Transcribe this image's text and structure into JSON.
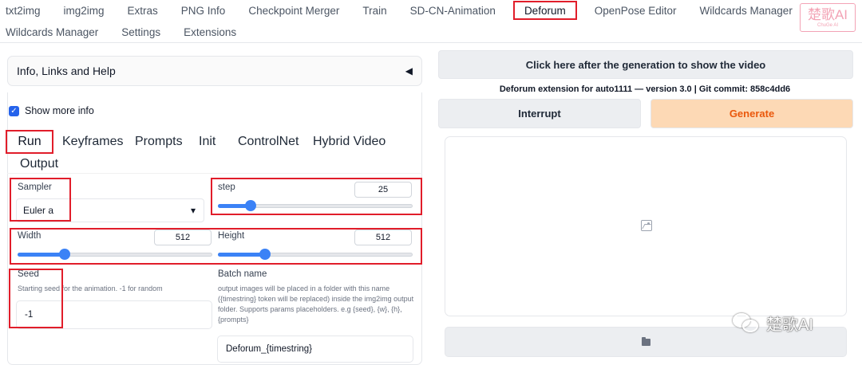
{
  "nav": {
    "tabs_row1": [
      "txt2img",
      "img2img",
      "Extras",
      "PNG Info",
      "Checkpoint Merger",
      "Train",
      "SD-CN-Animation",
      "Deforum",
      "OpenPose Editor",
      "Wildcards Manager"
    ],
    "tabs_row2": [
      "Wildcards Manager",
      "Settings",
      "Extensions"
    ],
    "active_tab": "Deforum",
    "logo_text": "楚歌AI",
    "logo_subtext": "ChuGe AI"
  },
  "left": {
    "accordion_label": "Info, Links and Help",
    "accordion_caret": "◀",
    "show_more_info_label": "Show more info",
    "show_more_info_checked": true,
    "subtabs": [
      "Run",
      "Keyframes",
      "Prompts",
      "Init",
      "ControlNet",
      "Hybrid Video",
      "Output"
    ],
    "active_subtab": "Run",
    "sampler": {
      "label": "Sampler",
      "value": "Euler a",
      "arrow": "▾"
    },
    "step": {
      "label": "step",
      "value": "25",
      "fraction": 0.17
    },
    "width": {
      "label": "Width",
      "value": "512",
      "fraction": 0.24
    },
    "height": {
      "label": "Height",
      "value": "512",
      "fraction": 0.24
    },
    "seed": {
      "label": "Seed",
      "hint": "Starting seed for the animation. -1 for random",
      "value": "-1"
    },
    "batch_name": {
      "label": "Batch name",
      "hint": "output images will be placed in a folder with this name ({timestring} token will be replaced) inside the img2img output folder. Supports params placeholders. e.g {seed}, {w}, {h}, {prompts}",
      "value": "Deforum_{timestring}"
    }
  },
  "right": {
    "show_video_button": "Click here after the generation to show the video",
    "version_text": "Deforum extension for auto1111 — version 3.0 | Git commit: 858c4dd6",
    "interrupt_button": "Interrupt",
    "generate_button": "Generate",
    "output_icon": "image-placeholder-icon",
    "folder_icon": "folder-icon"
  },
  "watermark": {
    "text": "楚歌AI"
  },
  "colors": {
    "accent": "#3b82f6",
    "highlight": "#e11d2a",
    "generate_bg": "#fdd9b5",
    "generate_text": "#ea580c"
  }
}
